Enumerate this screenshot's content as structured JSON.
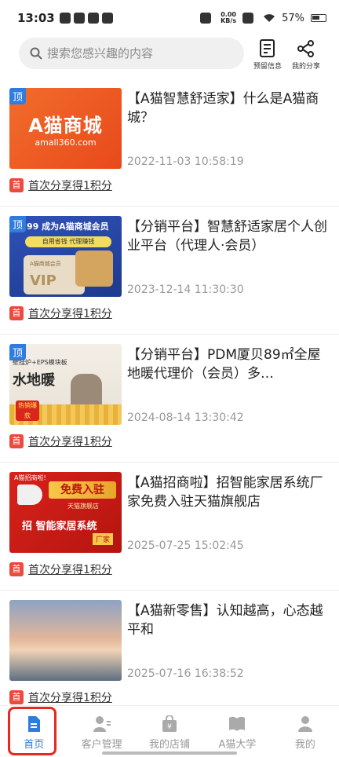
{
  "status": {
    "time": "13:03",
    "net_speed_top": "0.00",
    "net_speed_unit": "KB/s",
    "battery": "57%"
  },
  "search": {
    "placeholder": "搜索您感兴趣的内容"
  },
  "top_actions": {
    "reserve": "预留信息",
    "myshare": "我的分享"
  },
  "colors": {
    "accent": "#2f7ce0",
    "badge": "#e94b3c"
  },
  "articles": [
    {
      "pinned": "顶",
      "title": "【A猫智慧舒适家】什么是A猫商城？",
      "date": "2022-11-03 10:58:19",
      "share_badge": "首",
      "share_text": "首次分享得1积分",
      "thumb": {
        "big": "A猫商城",
        "small": "amall360.com"
      }
    },
    {
      "pinned": "顶",
      "title": "【分销平台】智慧舒适家居个人创业平台（代理人·会员）",
      "date": "2023-12-14 11:30:30",
      "share_badge": "首",
      "share_text": "首次分享得1积分",
      "thumb": {
        "band": "99 成为A猫商城会员",
        "strip": "自用省钱 代理赚钱",
        "card": "A猫商城会员",
        "vip": "VIP"
      }
    },
    {
      "pinned": "顶",
      "title": "【分销平台】PDM厦贝89㎡全屋地暖代理价（会员）多…",
      "date": "2024-08-14 13:30:42",
      "share_badge": "首",
      "share_text": "首次分享得1积分",
      "thumb": {
        "head": "壁挂炉+EPS模块板",
        "big": "水地暖",
        "hot": "热销爆款"
      }
    },
    {
      "title": "【A猫招商啦】招智能家居系统厂家免费入驻天猫旗舰店",
      "date": "2025-07-25 15:02:45",
      "share_badge": "首",
      "share_text": "首次分享得1积分",
      "thumb": {
        "corner": "A猫招商啦!",
        "ribbon": "免费入驻",
        "sub": "天猫旗舰店",
        "main": "招 智能家居系统",
        "tag": "厂家"
      }
    },
    {
      "title": "【A猫新零售】认知越高，心态越平和",
      "date": "2025-07-16 16:38:52",
      "share_badge": "首",
      "share_text": "首次分享得1积分"
    }
  ],
  "tabs": [
    {
      "label": "首页",
      "icon": "document-icon"
    },
    {
      "label": "客户管理",
      "icon": "customer-icon"
    },
    {
      "label": "我的店铺",
      "icon": "shop-icon"
    },
    {
      "label": "A猫大学",
      "icon": "book-icon"
    },
    {
      "label": "我的",
      "icon": "person-icon"
    }
  ]
}
